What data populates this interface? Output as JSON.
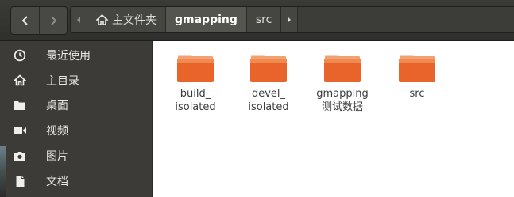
{
  "toolbar": {
    "back_icon": "chevron-left-icon",
    "forward_icon": "chevron-right-icon"
  },
  "breadcrumbs": [
    {
      "label": "主文件夹",
      "icon": "home-icon"
    },
    {
      "label": "gmapping",
      "active": true
    },
    {
      "label": "src"
    }
  ],
  "sidebar": {
    "items": [
      {
        "label": "最近使用",
        "icon": "clock-icon"
      },
      {
        "label": "主目录",
        "icon": "home-icon"
      },
      {
        "label": "桌面",
        "icon": "desktop-folder-icon"
      },
      {
        "label": "视频",
        "icon": "video-icon"
      },
      {
        "label": "图片",
        "icon": "camera-icon"
      },
      {
        "label": "文档",
        "icon": "document-icon"
      }
    ]
  },
  "files": [
    {
      "label": "build_\nisolated",
      "icon": "folder-icon"
    },
    {
      "label": "devel_\nisolated",
      "icon": "folder-icon"
    },
    {
      "label": "gmapping\n测试数据",
      "icon": "folder-icon"
    },
    {
      "label": "src",
      "icon": "folder-icon"
    }
  ],
  "colors": {
    "folder_top": "#f7a06e",
    "folder_body": "#e8642b",
    "header_bg": "#353532",
    "sidebar_bg": "#3c3b37"
  }
}
